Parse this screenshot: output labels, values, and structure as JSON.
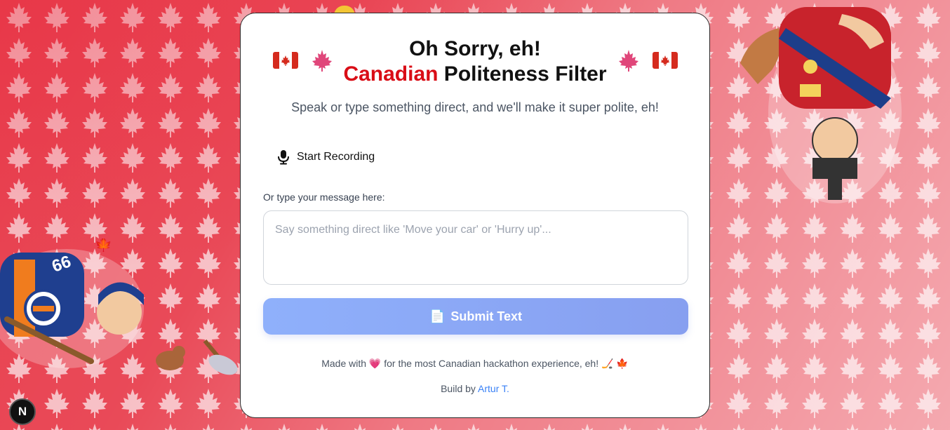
{
  "header": {
    "title_line1": "Oh Sorry, eh!",
    "title_red": "Canadian",
    "title_rest": " Politeness Filter",
    "subtitle": "Speak or type something direct, and we'll make it super polite, eh!"
  },
  "recorder": {
    "label": "Start Recording",
    "icon": "microphone-icon"
  },
  "input": {
    "label": "Or type your message here:",
    "placeholder": "Say something direct like 'Move your car' or 'Hurry up'...",
    "value": ""
  },
  "submit": {
    "icon": "📄",
    "label": "Submit Text"
  },
  "footer": {
    "made_with_prefix": "Made with",
    "heart": "💗",
    "made_with_suffix": "for the most Canadian hackathon experience, eh! 🏒 🍁",
    "credit_prefix": "Build by",
    "credit_link": "Artur T."
  },
  "badge": {
    "letter": "N"
  },
  "colors": {
    "accent_red": "#d90d16",
    "background_red": "#e8404f",
    "button_start": "#8fb0fb",
    "button_end": "#879ff0",
    "link_blue": "#3b82f6"
  }
}
